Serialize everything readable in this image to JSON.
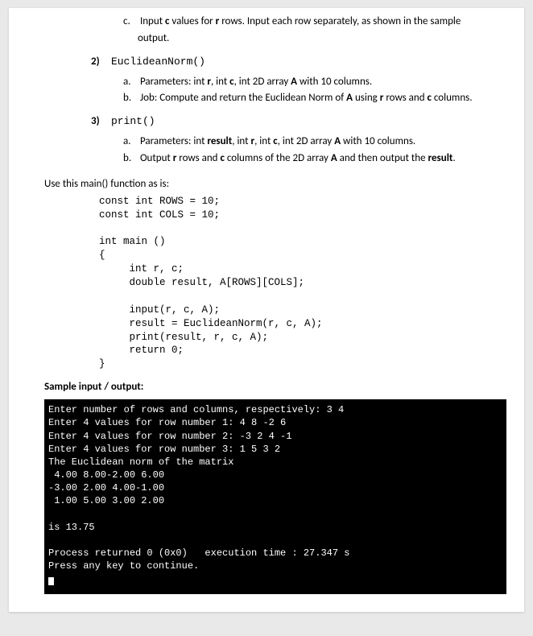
{
  "q1": {
    "c_label": "c.",
    "c_text_pre": "Input ",
    "c_text_c": "c",
    "c_text_mid1": " values for ",
    "c_text_r": "r",
    "c_text_post": " rows. Input each row separately, as shown in the sample",
    "c_text_line2": "output."
  },
  "q2": {
    "num": "2)",
    "fname": "EuclideanNorm()",
    "a_label": "a.",
    "a_text_pre": "Parameters: int ",
    "a_r": "r",
    "a_mid1": ", int ",
    "a_c": "c",
    "a_mid2": ", int 2D array ",
    "a_A": "A",
    "a_post": " with 10 columns.",
    "b_label": "b.",
    "b_pre": "Job: Compute and return the Euclidean Norm of ",
    "b_A": "A",
    "b_mid1": " using ",
    "b_r": "r",
    "b_mid2": " rows and ",
    "b_c": "c",
    "b_post": " columns."
  },
  "q3": {
    "num": "3)",
    "fname": "print()",
    "a_label": "a.",
    "a_pre": "Parameters: int ",
    "a_result": "result",
    "a_mid1": ", int ",
    "a_r": "r",
    "a_mid2": ", int ",
    "a_c": "c",
    "a_mid3": ", int 2D array ",
    "a_A": "A",
    "a_post": " with 10 columns.",
    "b_label": "b.",
    "b_pre": "Output ",
    "b_r": "r",
    "b_mid1": " rows and ",
    "b_c": "c",
    "b_mid2": " columns of the 2D array ",
    "b_A": "A",
    "b_mid3": " and then output the ",
    "b_result": "result",
    "b_post": "."
  },
  "use_main": "Use this main() function as is:",
  "code": "const int ROWS = 10;\nconst int COLS = 10;\n\nint main ()\n{\n     int r, c;\n     double result, A[ROWS][COLS];\n\n     input(r, c, A);\n     result = EuclideanNorm(r, c, A);\n     print(result, r, c, A);\n     return 0;\n}",
  "sample_title": "Sample input / output:",
  "terminal": {
    "l1": "Enter number of rows and columns, respectively: 3 4",
    "l2": "Enter 4 values for row number 1: 4 8 -2 6",
    "l3": "Enter 4 values for row number 2: -3 2 4 -1",
    "l4": "Enter 4 values for row number 3: 1 5 3 2",
    "l5": "The Euclidean norm of the matrix",
    "l6": " 4.00 8.00-2.00 6.00",
    "l7": "-3.00 2.00 4.00-1.00",
    "l8": " 1.00 5.00 3.00 2.00",
    "blank": "",
    "l9": "is 13.75",
    "l10": "Process returned 0 (0x0)   execution time : 27.347 s",
    "l11": "Press any key to continue."
  }
}
